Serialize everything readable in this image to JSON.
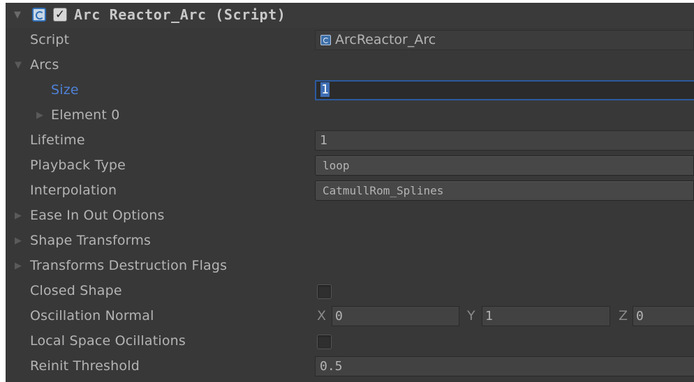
{
  "header": {
    "title": "Arc Reactor_Arc (Script)",
    "enabled_mark": "✓"
  },
  "rows": {
    "script": {
      "label": "Script",
      "value": "ArcReactor_Arc"
    },
    "arcs": {
      "label": "Arcs"
    },
    "size": {
      "label": "Size",
      "value": "1"
    },
    "element0": {
      "label": "Element 0"
    },
    "lifetime": {
      "label": "Lifetime",
      "value": "1"
    },
    "playback_type": {
      "label": "Playback Type",
      "value": "loop"
    },
    "interpolation": {
      "label": "Interpolation",
      "value": "CatmullRom_Splines"
    },
    "ease": {
      "label": "Ease In Out Options"
    },
    "shape_transforms": {
      "label": "Shape Transforms"
    },
    "destruction_flags": {
      "label": "Transforms Destruction Flags"
    },
    "closed_shape": {
      "label": "Closed Shape",
      "checked": false
    },
    "oscillation_normal": {
      "label": "Oscillation Normal",
      "x_label": "X",
      "x": "0",
      "y_label": "Y",
      "y": "1",
      "z_label": "Z",
      "z": "0"
    },
    "local_space": {
      "label": "Local Space Ocillations",
      "checked": false
    },
    "reinit": {
      "label": "Reinit Threshold",
      "value": "0.5"
    }
  },
  "icons": {
    "foldout_open": "▼",
    "foldout_closed": "▶"
  },
  "colors": {
    "panel_bg": "#383838",
    "text": "#b4b4b4",
    "focus_blue": "#2c5aa0",
    "label_blue": "#4f82d8"
  }
}
